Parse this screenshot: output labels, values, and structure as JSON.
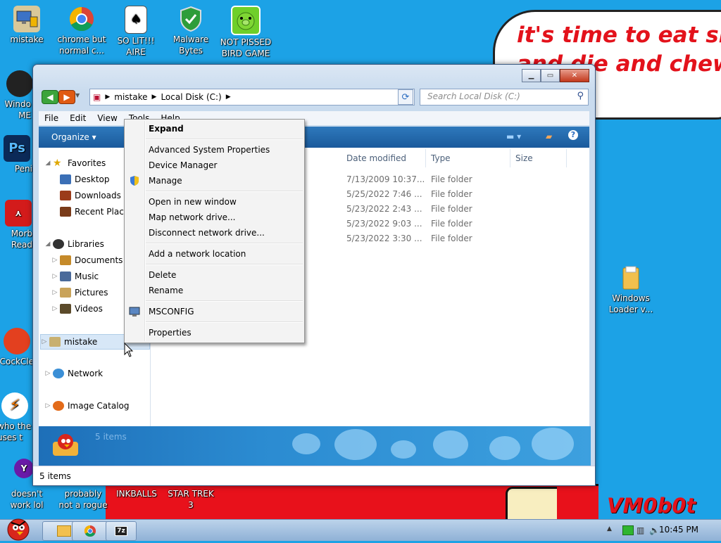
{
  "wallpaper": {
    "speech_text": "it's time to eat shit\nand die and chew\ngum",
    "tag": "VM0b0t"
  },
  "desktop_icons": [
    {
      "label": "mistake",
      "icon": "computer-icon"
    },
    {
      "label": "chrome but normal c...",
      "icon": "chrome-icon"
    },
    {
      "label": "SO LIT!!! AIRE",
      "icon": "solitaire-icon"
    },
    {
      "label": "Malware Bytes",
      "icon": "shield-icon"
    },
    {
      "label": "NOT PISSED BIRD GAME",
      "icon": "pig-icon"
    },
    {
      "label": "Windo ME",
      "icon": "drive-icon"
    },
    {
      "label": "Peni",
      "icon": "photoshop-icon"
    },
    {
      "label": "Morb Read",
      "icon": "pdf-icon"
    },
    {
      "label": "CockCle",
      "icon": "ccleaner-icon"
    },
    {
      "label": "who the uses t",
      "icon": "avast-icon"
    },
    {
      "label": "doesn't work lol",
      "icon": "yahoo-icon"
    },
    {
      "label": "probably not a rogue",
      "icon": "blank-icon"
    },
    {
      "label": "INKBALLS",
      "icon": "blank-icon"
    },
    {
      "label": "STAR TREK 3",
      "icon": "blank-icon"
    },
    {
      "label": "Windows Loader v...",
      "icon": "folder-icon"
    }
  ],
  "window": {
    "breadcrumb": [
      "mistake",
      "Local Disk (C:)"
    ],
    "search_placeholder": "Search Local Disk (C:)",
    "menu": [
      "File",
      "Edit",
      "View",
      "Tools",
      "Help"
    ],
    "toolbar": {
      "organize": "Organize"
    },
    "nav": {
      "favorites": "Favorites",
      "favorites_items": [
        "Desktop",
        "Downloads",
        "Recent Place"
      ],
      "libraries": "Libraries",
      "libraries_items": [
        "Documents",
        "Music",
        "Pictures",
        "Videos"
      ],
      "computer": "mistake",
      "network": "Network",
      "image_catalog": "Image Catalog"
    },
    "columns": {
      "date": "Date modified",
      "type": "Type",
      "size": "Size"
    },
    "rows": [
      {
        "date": "7/13/2009 10:37...",
        "type": "File folder"
      },
      {
        "date": "5/25/2022 7:46 ...",
        "type": "File folder"
      },
      {
        "date": "5/23/2022 2:43 ...",
        "type": "File folder"
      },
      {
        "date": "5/23/2022 9:03 ...",
        "type": "File folder"
      },
      {
        "date": "5/23/2022 3:30 ...",
        "type": "File folder"
      }
    ],
    "details_count": "5 items",
    "status": "5 items"
  },
  "context_menu": {
    "expand": "Expand",
    "advanced": "Advanced System Properties",
    "device_manager": "Device Manager",
    "manage": "Manage",
    "open_new": "Open in new window",
    "map_drive": "Map network drive...",
    "disconnect": "Disconnect network drive...",
    "add_location": "Add a network location",
    "delete": "Delete",
    "rename": "Rename",
    "msconfig": "MSCONFIG",
    "properties": "Properties"
  },
  "taskbar": {
    "clock": "10:45 PM"
  }
}
